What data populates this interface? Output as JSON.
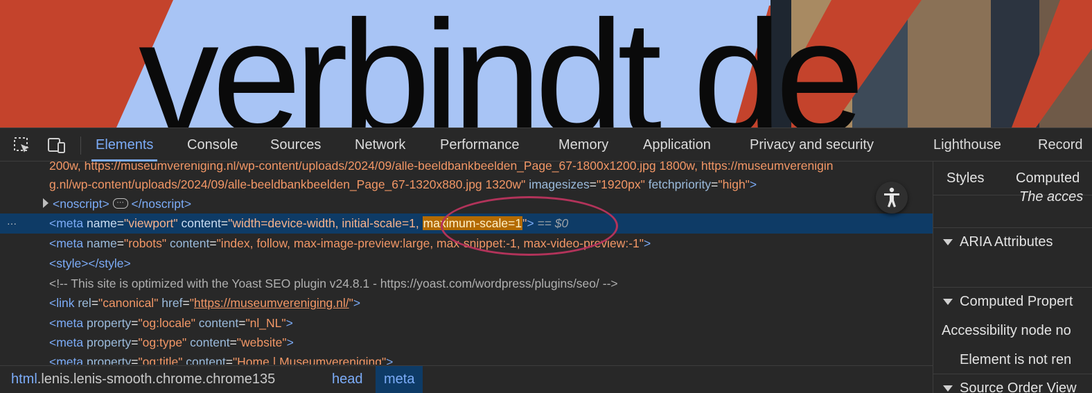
{
  "hero": {
    "word": "verbindt de",
    "colors": {
      "red": "#c4432c",
      "blue": "#a8c4f5",
      "text": "#0a0a0a"
    }
  },
  "toolbar": {
    "inspect_icon": "inspect-element-icon",
    "device_icon": "device-toolbar-icon",
    "tabs": [
      "Elements",
      "Console",
      "Sources",
      "Network",
      "Performance",
      "Memory",
      "Application",
      "Privacy and security",
      "Lighthouse",
      "Record"
    ],
    "active_tab": "Elements"
  },
  "tree": {
    "line0": "200w, https://museumvereniging.nl/wp-content/uploads/2024/09/alle-beeldbankbeelden_Page_67-1800x1200.jpg 1800w, https://museumverenigin",
    "line1_value": "g.nl/wp-content/uploads/2024/09/alle-beeldbankbeelden_Page_67-1320x880.jpg 1320w\"",
    "line1_attr1": "imagesizes",
    "line1_val1": "\"1920px\"",
    "line1_attr2": "fetchpriority",
    "line1_val2": "\"high\"",
    "noscript_open": "<noscript>",
    "noscript_close": "</noscript>",
    "ellipsis": "···",
    "selected_dots": "···",
    "meta1": {
      "tag": "<meta",
      "a1": "name",
      "v1": "\"viewport\"",
      "a2": "content",
      "v2a": "\"width=device-width, initial-scale=1, ",
      "v2hl": "maximum-scale=1",
      "v2b": "\"",
      "end": ">",
      "eq": "== $0"
    },
    "meta2": {
      "tag": "<meta",
      "a1": "name",
      "v1": "\"robots\"",
      "a2": "content",
      "v2": "\"index, follow, max-image-preview:large, max-snippet:-1, max-video-preview:-1\"",
      "end": ">"
    },
    "style_line": "<style></style>",
    "comment": "<!-- This site is optimized with the Yoast SEO plugin v24.8.1 - https://yoast.com/wordpress/plugins/seo/ -->",
    "link": {
      "tag": "<link",
      "a1": "rel",
      "v1": "\"canonical\"",
      "a2": "href",
      "q": "\"",
      "url": "https://museumvereniging.nl/",
      "end": ">"
    },
    "og_locale": {
      "tag": "<meta",
      "a1": "property",
      "v1": "\"og:locale\"",
      "a2": "content",
      "v2": "\"nl_NL\"",
      "end": ">"
    },
    "og_type": {
      "tag": "<meta",
      "a1": "property",
      "v1": "\"og:type\"",
      "a2": "content",
      "v2": "\"website\"",
      "end": ">"
    },
    "og_title": {
      "tag": "<meta",
      "a1": "property",
      "v1": "\"og:title\"",
      "a2": "content",
      "v2": "\"Home | Museumvereniging\"",
      "end": ">"
    }
  },
  "breadcrumb": [
    {
      "tag": "html",
      "classes": ".lenis.lenis-smooth.chrome.chrome135"
    },
    {
      "tag": "head",
      "classes": ""
    },
    {
      "tag": "meta",
      "classes": ""
    }
  ],
  "side": {
    "tabs": [
      "Styles",
      "Computed"
    ],
    "truncated_text": "The acces",
    "sections": [
      "ARIA Attributes",
      "Computed Propert",
      "Source Order View"
    ],
    "row1": "Accessibility node no",
    "row2": "Element is not ren"
  },
  "a11y_icon": "accessibility-person-icon",
  "annotation_color": "#b2335a"
}
